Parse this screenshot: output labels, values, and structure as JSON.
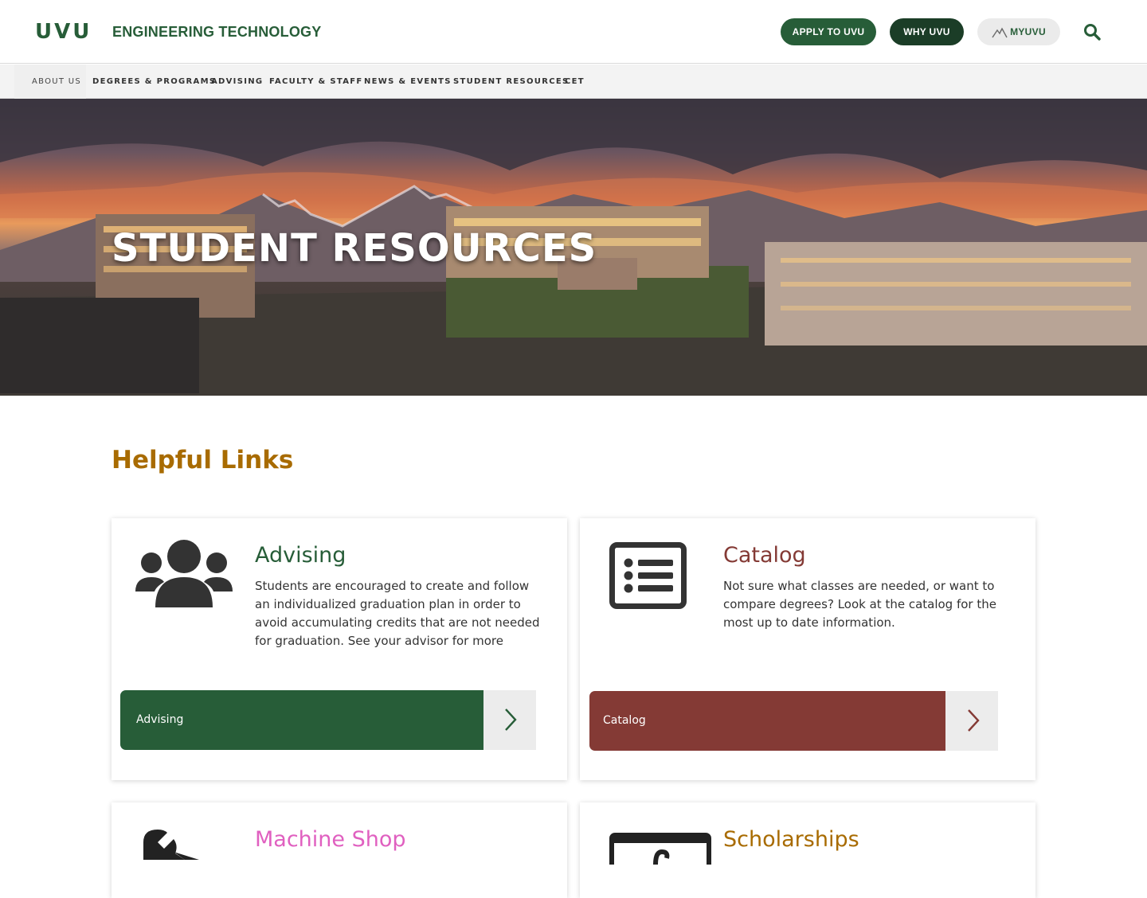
{
  "header": {
    "logo": "UVU",
    "site_title": "ENGINEERING TECHNOLOGY",
    "apply_label": "APPLY TO UVU",
    "why_label": "WHY UVU",
    "myuvu_label": "MYUVU"
  },
  "nav": {
    "items": [
      {
        "label": "ABOUT US"
      },
      {
        "label": "DEGREES & PROGRAMS"
      },
      {
        "label": "ADVISING"
      },
      {
        "label": "FACULTY & STAFF"
      },
      {
        "label": "NEWS & EVENTS"
      },
      {
        "label": "STUDENT RESOURCES"
      },
      {
        "label": "CET"
      }
    ]
  },
  "hero": {
    "title": "STUDENT RESOURCES"
  },
  "main": {
    "section_title": "Helpful Links",
    "cards": [
      {
        "title": "Advising",
        "text": "Students are encouraged to create and follow an individualized graduation plan in order to avoid accumulating credits that are not needed for graduation. See your advisor for more",
        "button_label": "Advising",
        "icon": "users-icon",
        "accent": "#275d38"
      },
      {
        "title": "Catalog",
        "text": "Not sure what classes are needed, or want to compare degrees? Look at the catalog for the most up to date information.",
        "button_label": "Catalog",
        "icon": "list-icon",
        "accent": "#843a35"
      },
      {
        "title": "Machine Shop",
        "icon": "wrench-icon",
        "accent": "#e060c0"
      },
      {
        "title": "Scholarships",
        "icon": "money-icon",
        "accent": "#a86b00"
      }
    ]
  },
  "colors": {
    "brand_green": "#275d38",
    "dark_green": "#1b3d27",
    "gold": "#a86b00",
    "maroon": "#843a35"
  }
}
